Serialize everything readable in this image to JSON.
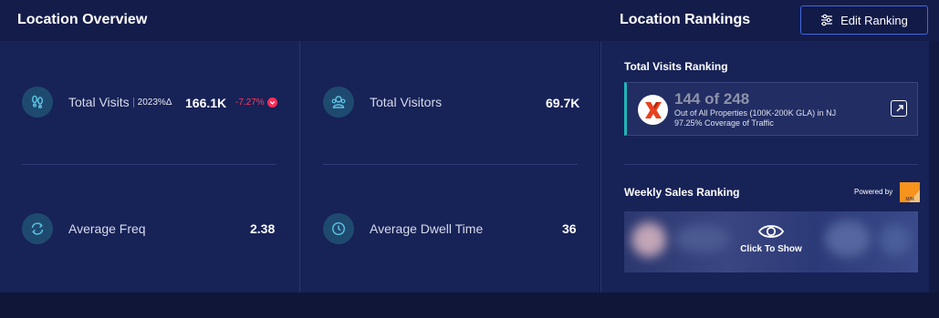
{
  "overview": {
    "title": "Location Overview",
    "metrics": [
      {
        "label": "Total Visits",
        "year": "2023%Δ",
        "value": "166.1K",
        "change": "-7.27%",
        "icon": "footsteps-icon"
      },
      {
        "label": "Total Visitors",
        "value": "69.7K",
        "icon": "visitors-icon"
      },
      {
        "label": "Average Freq",
        "value": "2.38",
        "icon": "refresh-cycle-icon"
      },
      {
        "label": "Average Dwell Time",
        "value": "36",
        "icon": "clock-icon"
      }
    ]
  },
  "rankings": {
    "title": "Location Rankings",
    "edit_label": "Edit Ranking",
    "total_visits": {
      "title": "Total Visits Ranking",
      "rank": "144 of 248",
      "line1": "Out of All Properties (100K-200K GLA) in NJ",
      "line2": "97.25% Coverage of Traffic"
    },
    "weekly_sales": {
      "title": "Weekly Sales Ranking",
      "powered_by": "Powered by",
      "logo_text": "M/N",
      "click_label": "Click To Show"
    }
  },
  "colors": {
    "accent": "#1fb5b8",
    "negative": "#ff2d55",
    "button_border": "#3f6ae0"
  }
}
